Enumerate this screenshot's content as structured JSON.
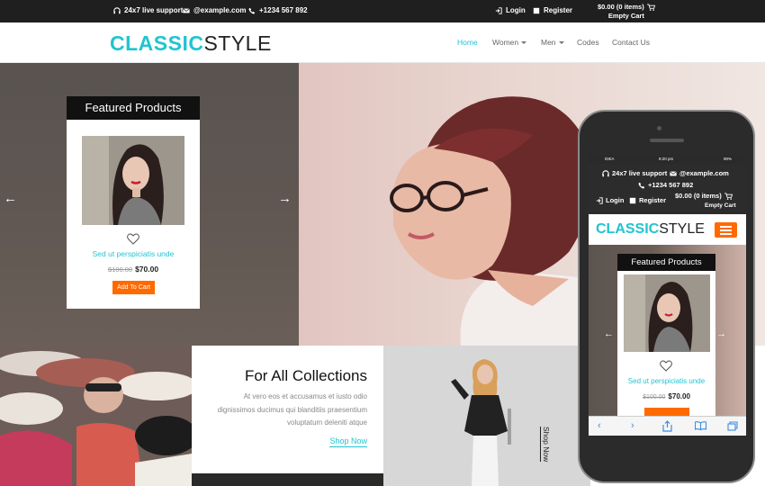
{
  "topbar": {
    "support": "24x7 live support",
    "email": "@example.com",
    "phone": "+1234 567 892",
    "login": "Login",
    "register": "Register",
    "cart_total": "$0.00 (0 items)",
    "cart_empty": "Empty Cart"
  },
  "header": {
    "logo_part1": "CLASSIC",
    "logo_part2": "STYLE",
    "nav": [
      "Home",
      "Women",
      "Men",
      "Codes",
      "Contact Us"
    ],
    "nav_active": "Home"
  },
  "hero": {
    "prev_arrow": "←",
    "next_arrow": "→"
  },
  "featured": {
    "title": "Featured Products",
    "product_name": "Sed ut perspiciatis unde",
    "old_price": "$100.00",
    "new_price": "$70.00",
    "button": "Add To Cart"
  },
  "collections": {
    "title": "For All Collections",
    "text": "At vero eos et accusamus et iusto odio dignissimos ducimus qui blanditiis praesentium voluptatum deleniti atque",
    "link": "Shop Now"
  },
  "side_panel": {
    "vertical_link": "Shop Now"
  },
  "phone": {
    "status_carrier": "IDEA",
    "status_time": "8:20 pm",
    "status_battery": "90%",
    "support": "24x7 live support",
    "email": "@example.com",
    "phone_number": "+1234 567 892",
    "login": "Login",
    "register": "Register",
    "cart_total": "$0.00 (0 items)",
    "cart_empty": "Empty Cart",
    "logo_part1": "CLASSIC",
    "logo_part2": "STYLE",
    "featured_title": "Featured Products",
    "product_name": "Sed ut perspiciatis unde",
    "old_price": "$100.00",
    "new_price": "$70.00"
  },
  "colors": {
    "accent": "#21c4d1",
    "button": "#ff6a00",
    "topbar": "#1f1f1f"
  }
}
